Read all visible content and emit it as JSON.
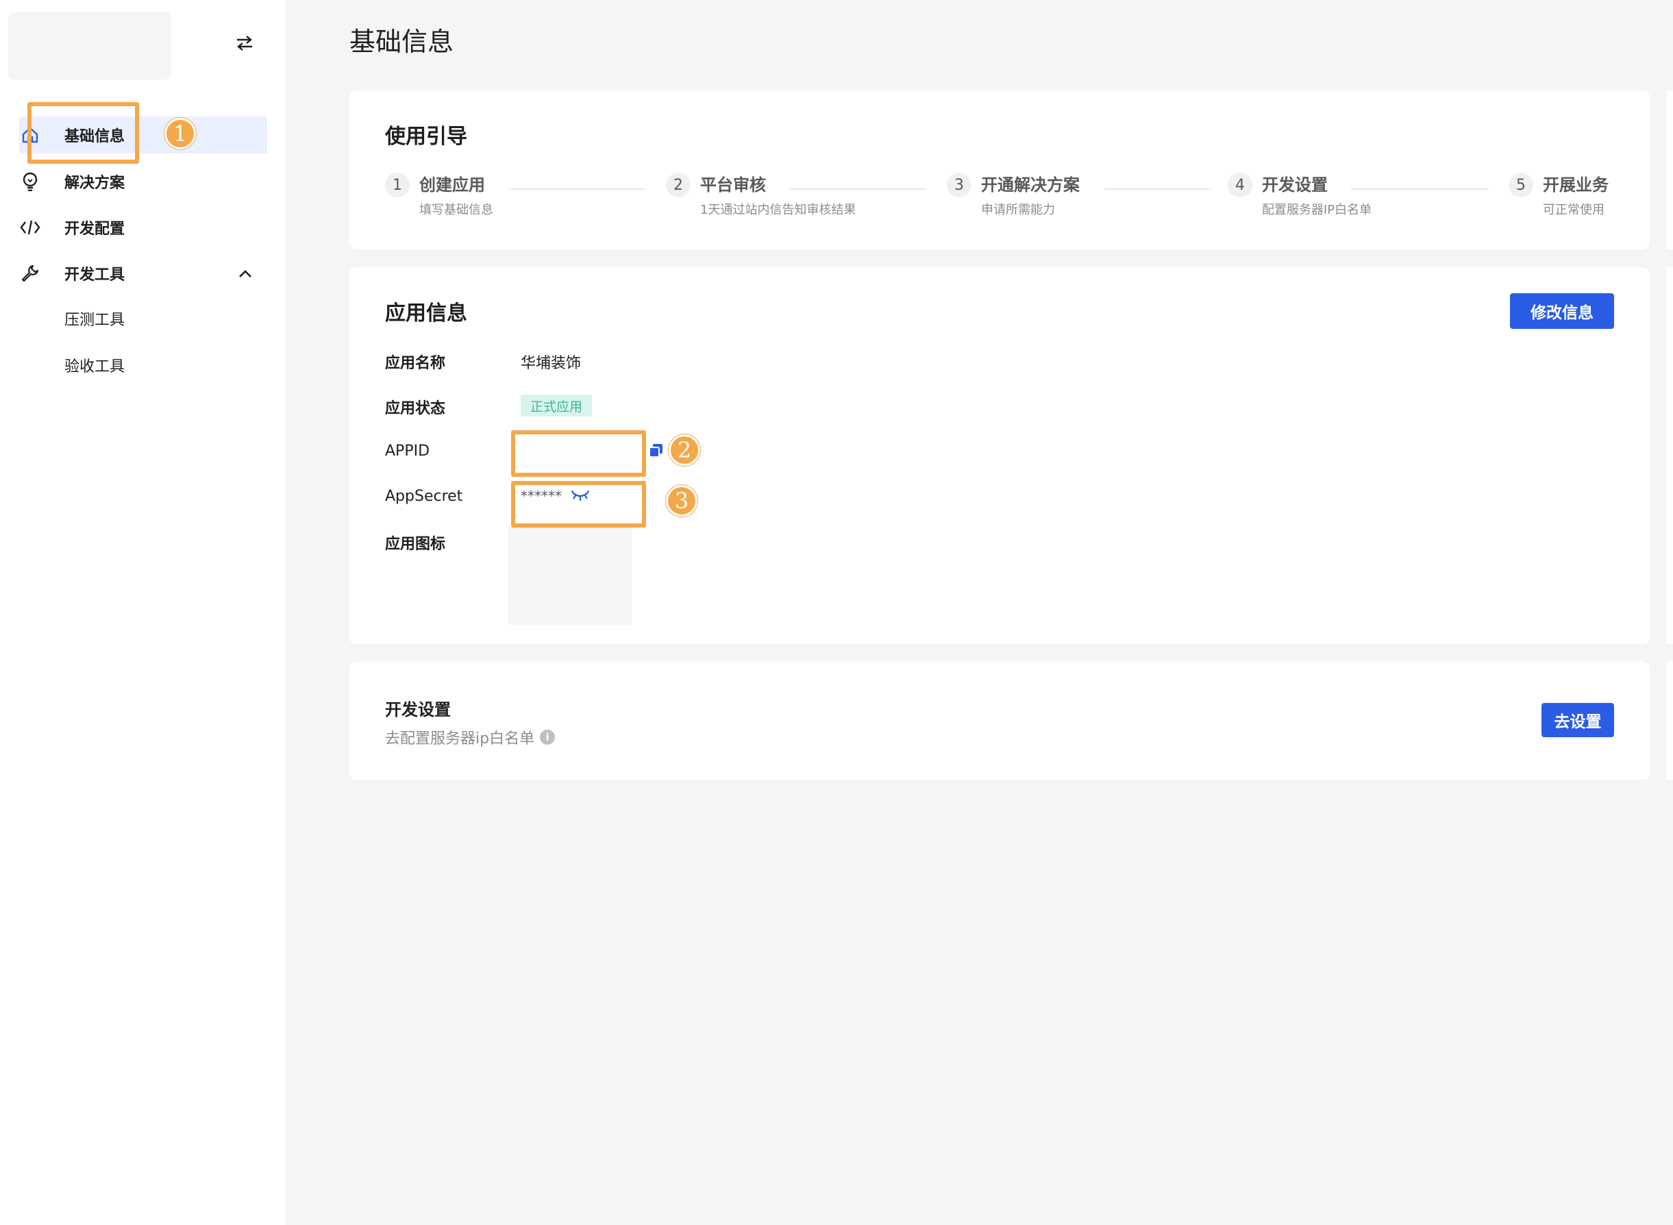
{
  "sidebar": {
    "items": [
      {
        "label": "基础信息",
        "icon": "home-icon",
        "active": true
      },
      {
        "label": "解决方案",
        "icon": "lightbulb-icon"
      },
      {
        "label": "开发配置",
        "icon": "code-icon"
      },
      {
        "label": "开发工具",
        "icon": "wrench-icon",
        "expanded": true
      }
    ],
    "sub_items": [
      {
        "label": "压测工具"
      },
      {
        "label": "验收工具"
      }
    ]
  },
  "page": {
    "title": "基础信息"
  },
  "guide": {
    "title": "使用引导",
    "steps": [
      {
        "num": "1",
        "title": "创建应用",
        "desc": "填写基础信息"
      },
      {
        "num": "2",
        "title": "平台审核",
        "desc": "1天通过站内信告知审核结果"
      },
      {
        "num": "3",
        "title": "开通解决方案",
        "desc": "申请所需能力"
      },
      {
        "num": "4",
        "title": "开发设置",
        "desc": "配置服务器IP白名单"
      },
      {
        "num": "5",
        "title": "开展业务",
        "desc": "可正常使用"
      }
    ]
  },
  "app_info": {
    "title": "应用信息",
    "edit_button": "修改信息",
    "name_label": "应用名称",
    "name_value": "华埔装饰",
    "status_label": "应用状态",
    "status_value": "正式应用",
    "appid_label": "APPID",
    "secret_label": "AppSecret",
    "secret_mask": "******",
    "icon_label": "应用图标"
  },
  "dev_settings": {
    "title": "开发设置",
    "desc": "去配置服务器ip白名单",
    "button": "去设置"
  },
  "annotations": [
    "1",
    "2",
    "3"
  ],
  "colors": {
    "primary": "#2b5ce6",
    "annotation": "#f3a84a",
    "status_bg": "#d9f4ee",
    "status_text": "#3bb899",
    "active_bg": "#eaf0ff"
  }
}
